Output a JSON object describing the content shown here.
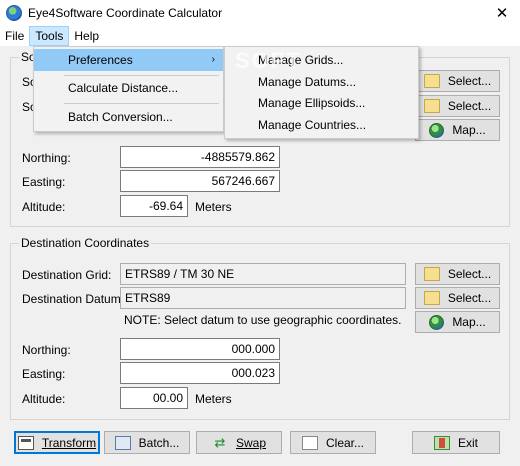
{
  "window": {
    "title": "Eye4Software Coordinate Calculator",
    "close_glyph": "✕"
  },
  "menu": {
    "file": "File",
    "tools": "Tools",
    "help": "Help"
  },
  "tools_menu": {
    "preferences": "Preferences",
    "calculate_distance": "Calculate Distance...",
    "batch_conversion": "Batch Conversion...",
    "submenu_arrow": "›"
  },
  "preferences_menu": {
    "grids": "Manage Grids...",
    "datums": "Manage Datums...",
    "ellipsoids": "Manage Ellipsoids...",
    "countries": "Manage Countries..."
  },
  "source": {
    "title_partial": "So",
    "row1_label_partial": "So",
    "row2_label_partial": "So",
    "select1": "Select...",
    "select2": "Select...",
    "map": "Map...",
    "northing_label": "Northing:",
    "northing": "-4885579.862",
    "easting_label": "Easting:",
    "easting": "567246.667",
    "altitude_label": "Altitude:",
    "altitude": "-69.64",
    "altitude_unit": "Meters"
  },
  "destination": {
    "title": "Destination Coordinates",
    "grid_label": "Destination Grid:",
    "grid": "ETRS89 / TM 30 NE",
    "datum_label": "Destination Datum:",
    "datum": "ETRS89",
    "note": "NOTE: Select datum to use geographic coordinates.",
    "select1": "Select...",
    "select2": "Select...",
    "map": "Map...",
    "northing_label": "Northing:",
    "northing": "000.000",
    "easting_label": "Easting:",
    "easting": "000.023",
    "altitude_label": "Altitude:",
    "altitude": "00.00",
    "altitude_unit": "Meters"
  },
  "buttons": {
    "transform": "Transform",
    "batch": "Batch...",
    "swap": "Swap",
    "clear": "Clear...",
    "exit": "Exit"
  },
  "watermark": "SOFT"
}
